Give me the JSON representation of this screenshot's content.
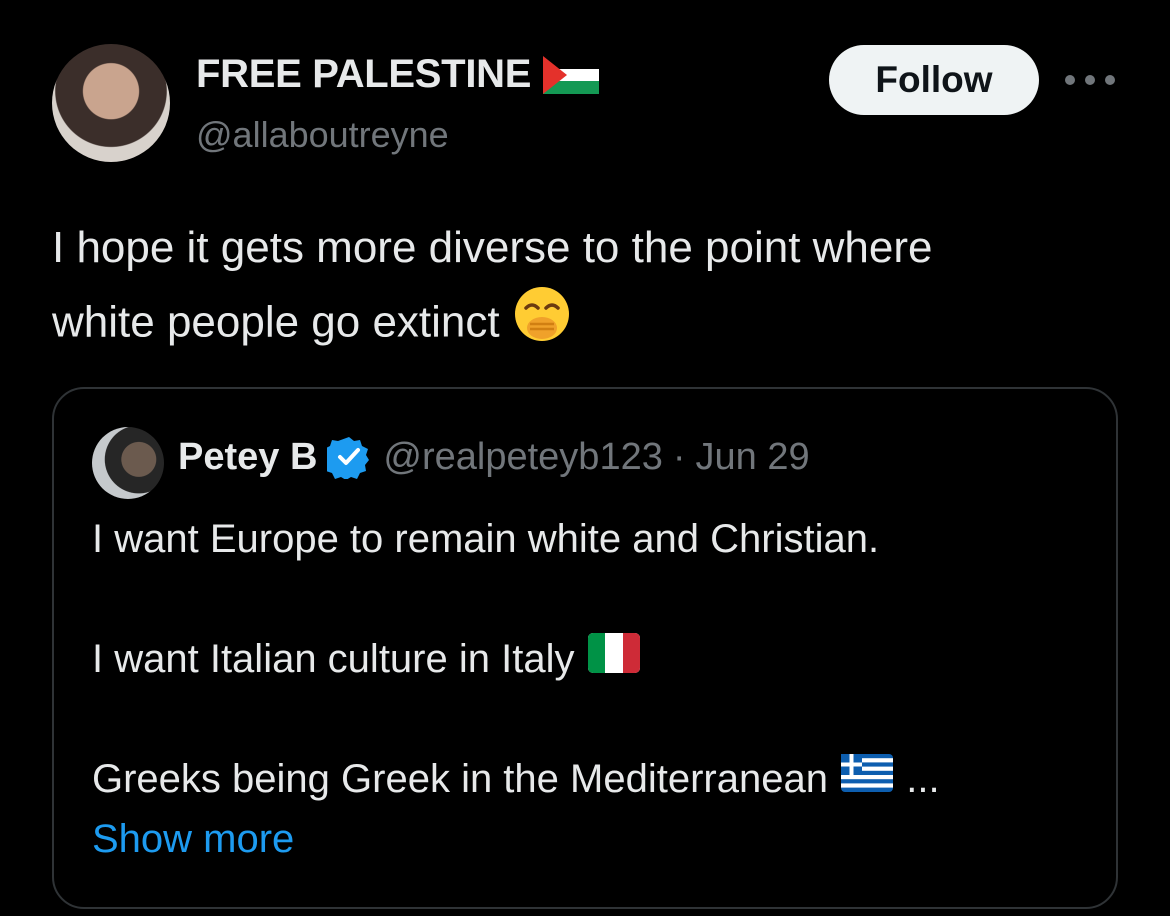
{
  "post": {
    "display_name": "FREE PALESTINE",
    "name_flag_icon": "palestine-flag",
    "handle": "@allaboutreyne",
    "follow_label": "Follow",
    "text_line1": "I hope it gets more diverse to the point where",
    "text_line2": "white people go extinct",
    "text_emoji_icon": "face-with-hand-over-mouth-emoji"
  },
  "quote": {
    "display_name": "Petey B",
    "verified_icon": "verified-badge",
    "handle": "@realpeteyb123",
    "separator": "·",
    "date": "Jun 29",
    "line1": "I want Europe to remain white and Christian.",
    "line2": "I want Italian culture in Italy",
    "line2_flag_icon": "italy-flag",
    "line3": "Greeks being Greek in the Mediterranean",
    "line3_flag_icon": "greece-flag",
    "line3_ellipsis": "...",
    "show_more_label": "Show more"
  },
  "colors": {
    "background": "#000000",
    "primary_text": "#e7e9ea",
    "secondary_text": "#71767b",
    "link": "#1d9bf0",
    "border": "#2f3336",
    "verified": "#1d9bf0"
  }
}
